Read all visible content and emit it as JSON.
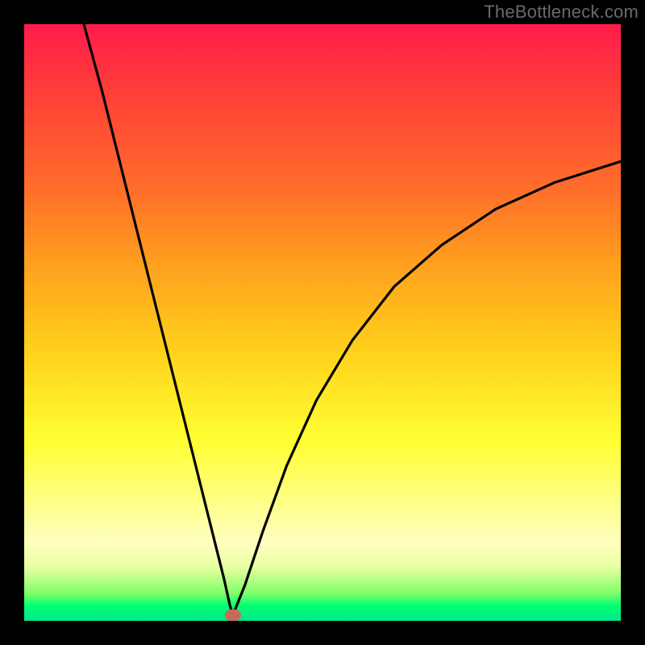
{
  "watermark": "TheBottleneck.com",
  "colors": {
    "frame": "#000000",
    "gradient_top": "#ff1c4b",
    "gradient_mid": "#ffd21b",
    "gradient_bottom": "#00e88c",
    "curve": "#000000",
    "marker": "#c76a5d"
  },
  "chart_data": {
    "type": "line",
    "title": "",
    "xlabel": "",
    "ylabel": "",
    "xlim": [
      0,
      100
    ],
    "ylim": [
      0,
      100
    ],
    "grid": false,
    "legend": false,
    "marker": {
      "x": 35,
      "y": 1
    },
    "series": [
      {
        "name": "left-branch",
        "x": [
          10.0,
          13.0,
          16.0,
          19.0,
          22.0,
          25.0,
          28.0,
          30.0,
          32.0,
          33.5,
          34.5,
          35.0
        ],
        "y": [
          100.0,
          89.0,
          77.0,
          65.0,
          53.0,
          41.0,
          29.0,
          21.0,
          13.0,
          7.0,
          2.5,
          1.0
        ]
      },
      {
        "name": "right-branch",
        "x": [
          35.0,
          37.0,
          40.0,
          44.0,
          49.0,
          55.0,
          62.0,
          70.0,
          79.0,
          89.0,
          100.0
        ],
        "y": [
          1.0,
          6.0,
          15.0,
          26.0,
          37.0,
          47.0,
          56.0,
          63.0,
          69.0,
          73.5,
          77.0
        ]
      }
    ]
  }
}
